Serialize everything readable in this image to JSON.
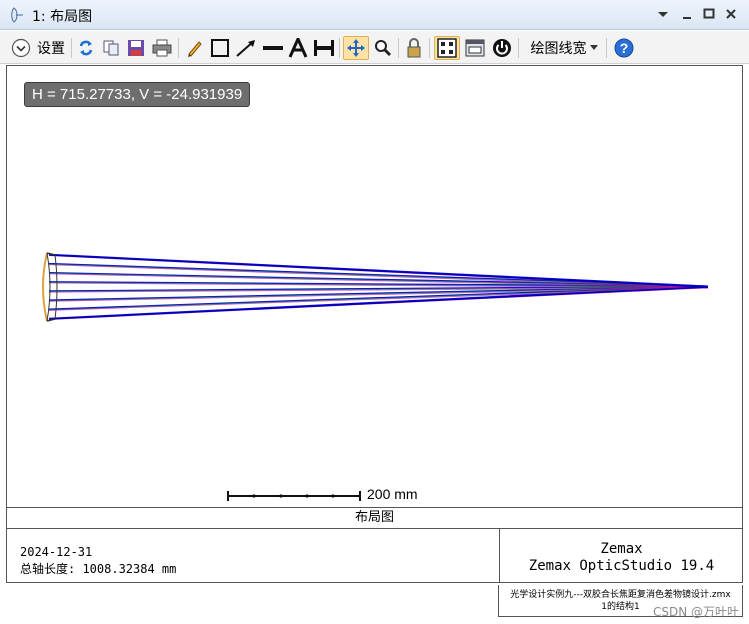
{
  "window": {
    "title": "1: 布局图",
    "buttons": [
      "dropdown",
      "minimize",
      "maximize",
      "close"
    ]
  },
  "toolbar": {
    "settings_label": "设置",
    "line_width_label": "绘图线宽",
    "active_tools": [
      "pan-tool",
      "fit-view-tool"
    ]
  },
  "plot": {
    "coord_readout": "H = 715.27733, V = -24.931939",
    "scale_bar_label": "200 mm",
    "caption": "布局图",
    "date": "2024-12-31",
    "axis_length": "总轴长度: 1008.32384 mm",
    "company": "Zemax",
    "product": "Zemax OpticStudio 19.4",
    "file_name": "光学设计实例九---双胶合长焦距复消色差物镜设计.zmx",
    "config": "1的结构1"
  },
  "watermark": "CSDN @万叶叶",
  "colors": {
    "ray_main": "#1010e0",
    "ray_alt1": "#00a000",
    "ray_alt2": "#c000c0",
    "lens_edge": "#e0a040"
  }
}
